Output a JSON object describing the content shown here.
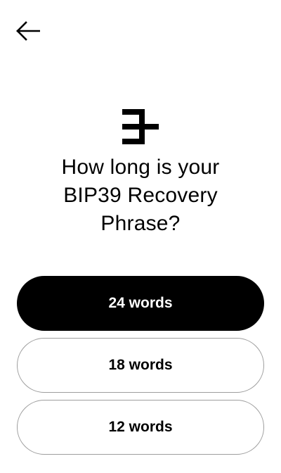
{
  "header": {
    "back_icon": "arrow-left-icon"
  },
  "logo": {
    "icon": "brand-logo"
  },
  "question": {
    "line1": "How long is your",
    "line2": "BIP39 Recovery",
    "line3": "Phrase?"
  },
  "options": [
    {
      "label": "24 words",
      "selected": true
    },
    {
      "label": "18 words",
      "selected": false
    },
    {
      "label": "12 words",
      "selected": false
    }
  ],
  "colors": {
    "primary": "#000000",
    "background": "#ffffff",
    "border": "#9d9d9d"
  }
}
